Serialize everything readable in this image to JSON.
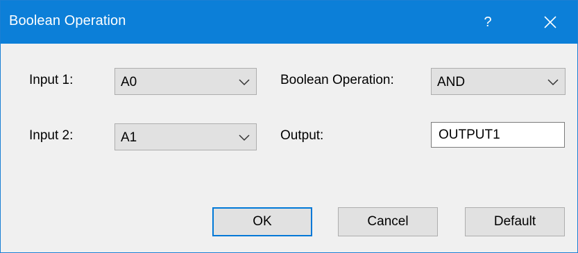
{
  "window": {
    "title": "Boolean Operation",
    "help_label": "?",
    "close_icon": "close-icon"
  },
  "form": {
    "input1": {
      "label": "Input 1:",
      "value": "A0"
    },
    "input2": {
      "label": "Input 2:",
      "value": "A1"
    },
    "operation": {
      "label": "Boolean Operation:",
      "value": "AND"
    },
    "output": {
      "label": "Output:",
      "value": "OUTPUT1"
    }
  },
  "buttons": {
    "ok": "OK",
    "cancel": "Cancel",
    "default": "Default"
  },
  "colors": {
    "titlebar": "#0c7fd8",
    "background": "#f0f0f0",
    "focus_border": "#0078d7"
  }
}
